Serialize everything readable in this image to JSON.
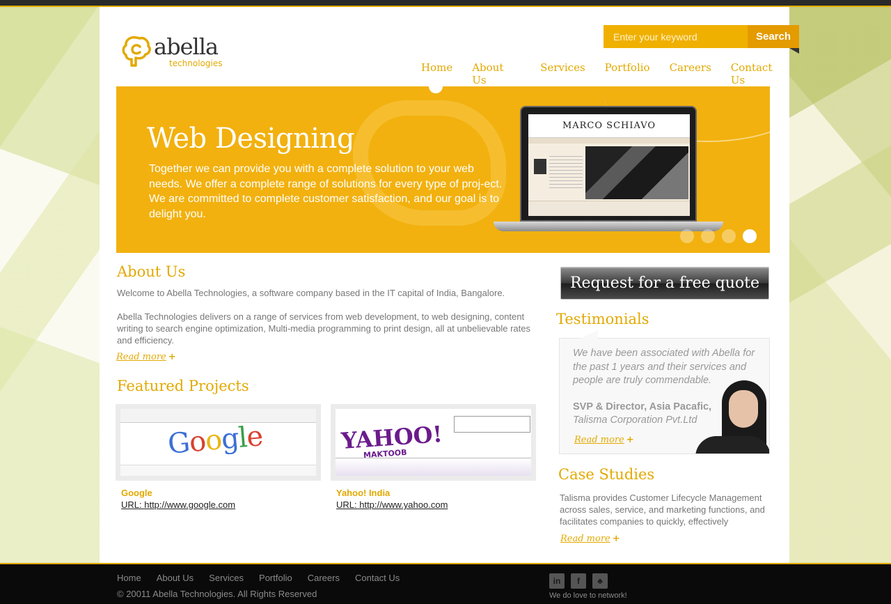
{
  "brand": {
    "name": "abella",
    "sub": "technologies"
  },
  "search": {
    "placeholder": "Enter your keyword",
    "button": "Search"
  },
  "nav": [
    "Home",
    "About Us",
    "Services",
    "Portfolio",
    "Careers",
    "Contact Us"
  ],
  "hero": {
    "title": "Web Designing",
    "text": "Together we can provide you with a complete solution to your web needs. We offer a complete range of solutions for every type of proj-ect. We are committed to complete customer satisfaction, and our goal is to delight you.",
    "screen_title": "MARCO SCHIAVO",
    "slides": 4,
    "active_slide": 4
  },
  "about": {
    "heading": "About Us",
    "p1": "Welcome to Abella Technologies, a software company based in the IT capital of India, Bangalore.",
    "p2": "Abella Technologies delivers on a range of services from web development, to web designing, content writing to search engine optimization, Multi-media programming to print design, all at unbelievable rates and efficiency.",
    "read_more": "Read more"
  },
  "featured": {
    "heading": "Featured Projects",
    "projects": [
      {
        "name": "Google",
        "url": "URL: http://www.google.com",
        "shot_logo": "Google"
      },
      {
        "name": "Yahoo! India",
        "url": "URL: http://www.yahoo.com",
        "shot_logo": "YAHOO!",
        "shot_sub": "MAKTOOB"
      }
    ]
  },
  "quote_button": "Request for a free quote",
  "testimonials": {
    "heading": "Testimonials",
    "quote": "We have been associated with Abella for the past 1 years and their services and people are truly commendable.",
    "role": "SVP & Director, Asia Pacafic,",
    "company": "Talisma Corporation Pvt.Ltd",
    "read_more": "Read more"
  },
  "case_studies": {
    "heading": "Case Studies",
    "text": "Talisma provides Customer Lifecycle Management across sales, service, and marketing functions, and facilitates companies to quickly, effectively",
    "read_more": "Read more"
  },
  "footer": {
    "nav": [
      "Home",
      "About Us",
      "Services",
      "Portfolio",
      "Careers",
      "Contact Us"
    ],
    "copyright": "© 20011 Abella Technologies. All Rights Reserved",
    "social": [
      {
        "icon": "linkedin-icon",
        "glyph": "in"
      },
      {
        "icon": "facebook-icon",
        "glyph": "f"
      },
      {
        "icon": "myspace-icon",
        "glyph": "♣"
      }
    ],
    "tagline": "We do love to network!"
  },
  "colors": {
    "accent": "#e2a900",
    "hero_bg": "#f2b10f",
    "footer_bg": "#0a0a0a"
  }
}
